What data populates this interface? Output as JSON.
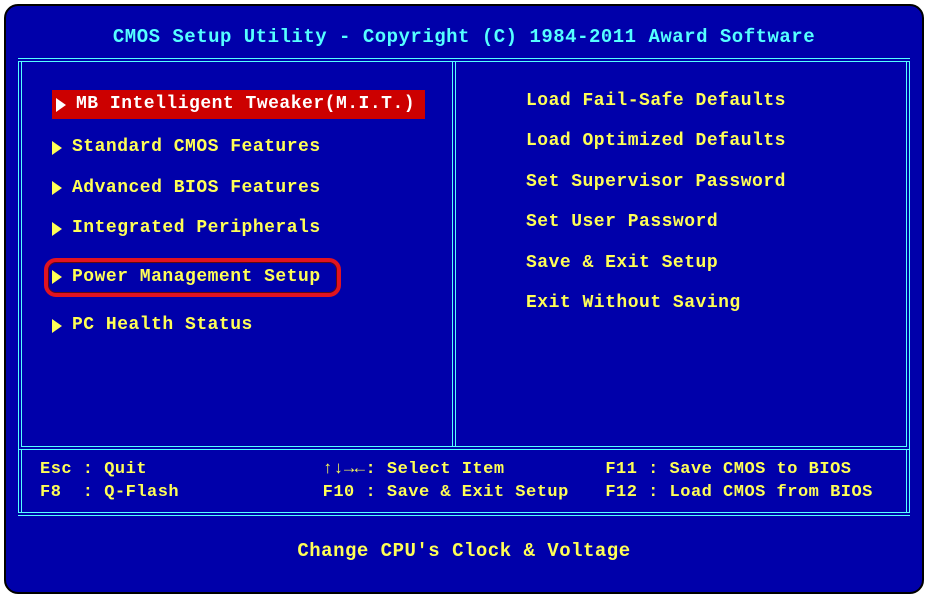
{
  "title": "CMOS Setup Utility - Copyright (C) 1984-2011 Award Software",
  "left_menu": [
    {
      "label": "MB Intelligent Tweaker(M.I.T.)",
      "selected": true,
      "highlighted": false,
      "has_arrow": true
    },
    {
      "label": "Standard CMOS Features",
      "selected": false,
      "highlighted": false,
      "has_arrow": true
    },
    {
      "label": "Advanced BIOS Features",
      "selected": false,
      "highlighted": false,
      "has_arrow": true
    },
    {
      "label": "Integrated Peripherals",
      "selected": false,
      "highlighted": false,
      "has_arrow": true
    },
    {
      "label": "Power Management Setup",
      "selected": false,
      "highlighted": true,
      "has_arrow": true
    },
    {
      "label": "PC Health Status",
      "selected": false,
      "highlighted": false,
      "has_arrow": true
    }
  ],
  "right_menu": [
    {
      "label": "Load Fail-Safe Defaults",
      "has_arrow": false
    },
    {
      "label": "Load Optimized Defaults",
      "has_arrow": false
    },
    {
      "label": "Set Supervisor Password",
      "has_arrow": false
    },
    {
      "label": "Set User Password",
      "has_arrow": false
    },
    {
      "label": "Save & Exit Setup",
      "has_arrow": false
    },
    {
      "label": "Exit Without Saving",
      "has_arrow": false
    }
  ],
  "hints": {
    "r1c1": "Esc : Quit",
    "r1c2": "↑↓→←: Select Item",
    "r1c3": "F11 : Save CMOS to BIOS",
    "r2c1": "F8  : Q-Flash",
    "r2c2": "F10 : Save & Exit Setup",
    "r2c3": "F12 : Load CMOS from BIOS"
  },
  "footer": "Change CPU's Clock & Voltage"
}
